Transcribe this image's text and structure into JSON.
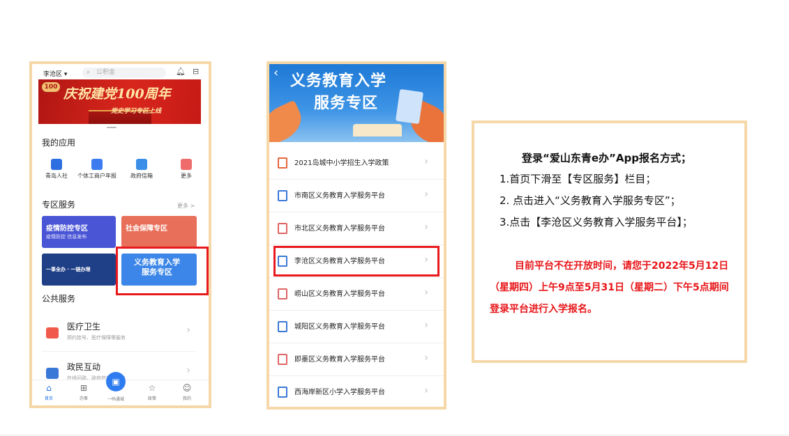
{
  "phone1": {
    "district": "李沧区 ▾",
    "search_placeholder": "公积金",
    "banner_logo": "100",
    "banner_title": "庆祝建党100周年",
    "banner_subtitle": "党史学习专区上线",
    "my_apps_title": "我的应用",
    "apps": [
      {
        "label": "青岛人社",
        "icon": "briefcase-icon",
        "color": "#2d6fe0"
      },
      {
        "label": "个体工商户年报",
        "icon": "report-icon",
        "color": "#3c7cf0"
      },
      {
        "label": "政府信箱",
        "icon": "mailbox-icon",
        "color": "#3a8ee8"
      },
      {
        "label": "更多",
        "icon": "grid-icon",
        "color": "#f06c6c"
      }
    ],
    "zone_title": "专区服务",
    "zone_more": "更多 >",
    "zone_tiles": [
      {
        "title": "疫情防控专区",
        "sub": "疫情防控 信息发布",
        "color": "#4a55d6"
      },
      {
        "title": "社会保障专区",
        "sub": "",
        "color": "#e8705a"
      },
      {
        "title": "一事全办 · 一链办理",
        "sub": "",
        "color": "#1f3f86"
      },
      {
        "title": "义务教育入学\n服务专区",
        "sub": "",
        "color": "#3b86e8"
      }
    ],
    "public_title": "公共服务",
    "public_items": [
      {
        "title": "医疗卫生",
        "sub": "预约挂号、医疗保障等服务",
        "icon": "medical-kit-icon"
      },
      {
        "title": "政民互动",
        "sub": "在线问政、政府信箱等服务",
        "icon": "chat-icon"
      }
    ],
    "tabs": [
      {
        "label": "首页",
        "icon": "home-icon"
      },
      {
        "label": "办事",
        "icon": "apps-icon"
      },
      {
        "label": "一码通城",
        "icon": "qr-code-icon"
      },
      {
        "label": "政策",
        "icon": "star-icon"
      },
      {
        "label": "我的",
        "icon": "person-icon"
      }
    ]
  },
  "phone2": {
    "hero_line1": "义务教育入学",
    "hero_line2": "服务专区",
    "items": [
      {
        "label": "2021岛城中小学招生入学政策",
        "icon": "envelope-icon",
        "color": "#e8663a"
      },
      {
        "label": "市南区义务教育入学服务平台",
        "icon": "document-icon",
        "color": "#3a78d8"
      },
      {
        "label": "市北区义务教育入学服务平台",
        "icon": "document-icon",
        "color": "#e06464"
      },
      {
        "label": "李沧区义务教育入学服务平台",
        "icon": "document-icon",
        "color": "#3a78d8"
      },
      {
        "label": "崂山区义务教育入学服务平台",
        "icon": "document-icon",
        "color": "#e06464"
      },
      {
        "label": "城阳区义务教育入学服务平台",
        "icon": "document-icon",
        "color": "#3a78d8"
      },
      {
        "label": "即墨区义务教育入学服务平台",
        "icon": "document-icon",
        "color": "#e06464"
      },
      {
        "label": "西海岸新区小学入学服务平台",
        "icon": "document-icon",
        "color": "#3a78d8"
      }
    ]
  },
  "card": {
    "heading": "登录“爱山东青e办”App报名方式；",
    "steps": [
      "1.首页下滑至【专区服务】栏目；",
      "2. 点击进入“义务教育入学服务专区”；",
      "3.点击【李沧区义务教育入学服务平台】；"
    ],
    "notice": "目前平台不在开放时间，请您于2022年5月12日（星期四）上午9点至5月31日（星期二）下午5点期间登录平台进行入学报名。",
    "notice_color": "#e81518"
  },
  "accent_border": "#f5d7a8",
  "highlight_color": "#e8191d"
}
